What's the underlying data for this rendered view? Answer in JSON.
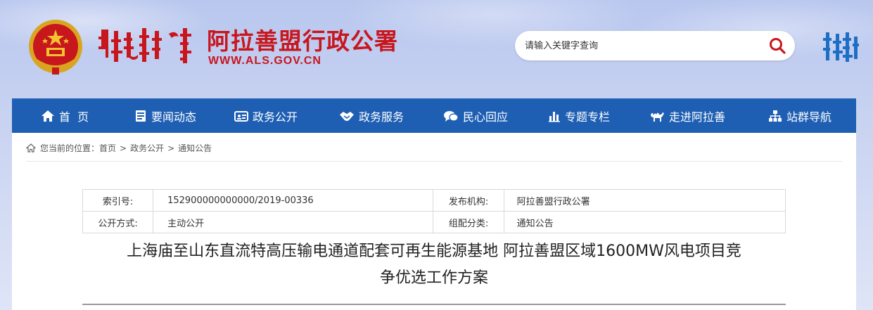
{
  "header": {
    "site_title": "阿拉善盟行政公署",
    "site_url": "WWW.ALS.GOV.CN",
    "search_placeholder": "请输入关键字查询"
  },
  "nav": {
    "items": [
      {
        "label": "首  页",
        "icon": "home-icon"
      },
      {
        "label": "要闻动态",
        "icon": "news-icon"
      },
      {
        "label": "政务公开",
        "icon": "id-card-icon"
      },
      {
        "label": "政务服务",
        "icon": "handshake-icon"
      },
      {
        "label": "民心回应",
        "icon": "chat-icon"
      },
      {
        "label": "专题专栏",
        "icon": "bar-chart-icon"
      },
      {
        "label": "走进阿拉善",
        "icon": "camel-icon"
      },
      {
        "label": "站群导航",
        "icon": "sitemap-icon"
      }
    ]
  },
  "breadcrumb": {
    "prefix": "您当前的位置：",
    "items": [
      "首页",
      "政务公开",
      "通知公告"
    ],
    "separator": ">"
  },
  "meta": {
    "index_label": "索引号:",
    "index_value": "152900000000000/2019-00336",
    "publisher_label": "发布机构:",
    "publisher_value": "阿拉善盟行政公署",
    "disclosure_label": "公开方式:",
    "disclosure_value": "主动公开",
    "category_label": "组配分类:",
    "category_value": "通知公告"
  },
  "article": {
    "title_line1": "上海庙至山东直流特高压输电通道配套可再生能源基地 阿拉善盟区域1600MW风电项目竞",
    "title_line2": "争优选工作方案"
  },
  "colors": {
    "brand_red": "#c8161d",
    "nav_blue": "#1e5fb3"
  }
}
